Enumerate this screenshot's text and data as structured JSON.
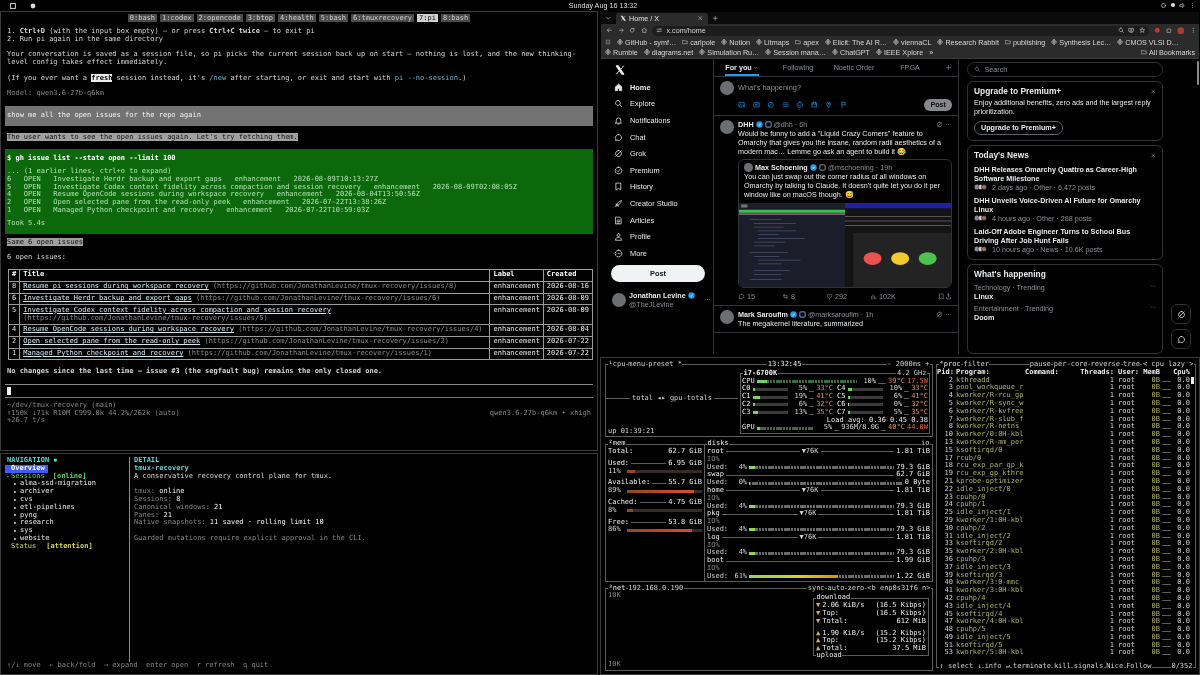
{
  "top_bar": {
    "clock": "Sunday Aug 16 13:32"
  },
  "terminal": {
    "windows": [
      {
        "label": "0:bash",
        "selected": false
      },
      {
        "label": "1:codex",
        "selected": false
      },
      {
        "label": "2:opencode",
        "selected": false
      },
      {
        "label": "3:btop",
        "selected": false
      },
      {
        "label": "4:health",
        "selected": false
      },
      {
        "label": "5:bash",
        "selected": false
      },
      {
        "label": "6:tmuxrecovery",
        "selected": false
      },
      {
        "label": "7:pi",
        "selected": true
      },
      {
        "label": "8:bash",
        "selected": false
      }
    ],
    "reply": {
      "steps": [
        "1. **Ctrl+D** (with the input box empty) — or press **Ctrl+C twice** — to exit pi",
        "2. Run pi again in the same directory"
      ],
      "paragraph": "Your conversation is saved as a session file, so pi picks the current session back up on start — nothing is lost, and the new thinking-level config takes effect immediately.",
      "note": [
        {
          "text": "(If you ever want a ",
          "kind": "plain"
        },
        {
          "text": "fresh",
          "kind": "highlight"
        },
        {
          "text": " session instead, it's ",
          "kind": "plain"
        },
        {
          "text": "/new",
          "kind": "command"
        },
        {
          "text": " after starting, or exit and start with ",
          "kind": "plain"
        },
        {
          "text": "pi --no-session",
          "kind": "command"
        },
        {
          "text": ".)",
          "kind": "plain"
        }
      ],
      "model": "Model: qwen3.6-27b-q6km"
    },
    "prompt": "show me all the open issues for the repo again",
    "thinking": "The user wants to see the open issues again. Let's try fetching them.",
    "tool": {
      "command": "$ gh issue list --state open --limit 100",
      "collapsed": "... (1 earlier lines, ctrl+o to expand)",
      "output": [
        "6   OPEN   Investigate Herdr backup and export gaps   enhancement   2026-08-09T10:13:27Z",
        "5   OPEN   Investigate Codex context fidelity across compaction and session recovery   enhancement   2026-08-09T02:08:05Z",
        "4   OPEN   Resume OpenCode sessions during workspace recovery   enhancement   2026-08-04T13:50:56Z",
        "2   OPEN   Open selected pane from the read-only peek   enhancement   2026-07-22T13:38:26Z",
        "1   OPEN   Managed Python checkpoint and recovery   enhancement   2026-07-22T10:59:03Z"
      ],
      "duration": "Took 5.4s"
    },
    "summary": "Same 6 open issues",
    "intro": "6 open issues:",
    "table": {
      "columns": [
        "#",
        "Title",
        "Label",
        "Created"
      ],
      "rows": [
        {
          "number": "8",
          "title": "Resume pi sessions during workspace recovery",
          "url": "(https://github.com/JonathanLevine/tmux-recovery/issues/8)",
          "label": "enhancement",
          "created": "2026-08-16"
        },
        {
          "number": "6",
          "title": "Investigate Herdr backup and export gaps",
          "url": "(https://github.com/JonathanLevine/tmux-recovery/issues/6)",
          "label": "enhancement",
          "created": "2026-08-09"
        },
        {
          "number": "5",
          "title": "Investigate Codex context fidelity across compaction and session recovery",
          "url": "(https://github.com/JonathanLevine/tmux-recovery/issues/5)",
          "label": "enhancement",
          "created": "2026-08-09"
        },
        {
          "number": "4",
          "title": "Resume OpenCode sessions during workspace recovery",
          "url": "(https://github.com/JonathanLevine/tmux-recovery/issues/4)",
          "label": "enhancement",
          "created": "2026-08-04"
        },
        {
          "number": "2",
          "title": "Open selected pane from the read-only peek",
          "url": "(https://github.com/JonathanLevine/tmux-recovery/issues/2)",
          "label": "enhancement",
          "created": "2026-07-22"
        },
        {
          "number": "1",
          "title": "Managed Python checkpoint and recovery",
          "url": "(https://github.com/JonathanLevine/tmux-recovery/issues/1)",
          "label": "enhancement",
          "created": "2026-07-22"
        }
      ]
    },
    "closing": "No changes since the last time — issue #3 (the segfault bug) remains the only closed one.",
    "footer": {
      "path": "~/dev/tmux-recovery (main)",
      "usage": "↑150k ↓71k R10M C999.0k 44.2%/262k (auto)",
      "speed": "+26.7 t/s",
      "model": "qwen3.6-27b-q6km • xhigh"
    }
  },
  "browser": {
    "tab": {
      "title": "Home / X"
    },
    "address": "x.com/home",
    "bookmarks": [
      {
        "label": "GitHub - symf…",
        "kind": "site"
      },
      {
        "label": "carlpole",
        "kind": "folder"
      },
      {
        "label": "Notion",
        "kind": "site"
      },
      {
        "label": "Litmaps",
        "kind": "site"
      },
      {
        "label": "apex",
        "kind": "folder"
      },
      {
        "label": "Elicit: The AI R…",
        "kind": "site"
      },
      {
        "label": "viennaCL",
        "kind": "site"
      },
      {
        "label": "Research Rabbit",
        "kind": "site"
      },
      {
        "label": "publishing",
        "kind": "folder"
      },
      {
        "label": "Synthesis Lec…",
        "kind": "site"
      },
      {
        "label": "CMOS VLSI D…",
        "kind": "site"
      },
      {
        "label": "Rumble",
        "kind": "site"
      },
      {
        "label": "diagrams.net",
        "kind": "site"
      },
      {
        "label": "Simulation Ru…",
        "kind": "site"
      },
      {
        "label": "Session mana…",
        "kind": "site"
      },
      {
        "label": "ChatGPT",
        "kind": "site"
      },
      {
        "label": "IEEE Xplore",
        "kind": "site"
      }
    ],
    "overflow": "»",
    "all_bookmarks": "All Bookmarks"
  },
  "x": {
    "nav": [
      {
        "label": "Home",
        "selected": true
      },
      {
        "label": "Explore",
        "selected": false
      },
      {
        "label": "Notifications",
        "selected": false
      },
      {
        "label": "Chat",
        "selected": false
      },
      {
        "label": "Grok",
        "selected": false
      },
      {
        "label": "Premium",
        "selected": false
      },
      {
        "label": "History",
        "selected": false
      },
      {
        "label": "Creator Studio",
        "selected": false
      },
      {
        "label": "Articles",
        "selected": false
      },
      {
        "label": "Profile",
        "selected": false
      },
      {
        "label": "More",
        "selected": false
      }
    ],
    "post_button": "Post",
    "account": {
      "name": "Jonathan Levine",
      "handle": "@TheJLevine"
    },
    "feed_tabs": [
      {
        "label": "For you",
        "selected": true
      },
      {
        "label": "Following",
        "selected": false
      },
      {
        "label": "Noetic Order",
        "selected": false
      },
      {
        "label": "FPGA",
        "selected": false
      }
    ],
    "composer": {
      "placeholder": "What's happening?",
      "post": "Post",
      "disabled": true
    },
    "tweets": [
      {
        "name": "DHH",
        "meta": "@dhh · 6h",
        "text": "Would be funny to add a \"Liquid Crazy Corners\" feature to Omarchy that gives you the insane, random radii aesthetics of a modern mac… Lemme go ask an agent to build it 😂",
        "quote": {
          "name": "Max Schoening",
          "meta": "@mschoening · 19h",
          "text": "You can just swap out the corner radius of all windows on Omarchy by talking to Claude. It doesn't quite let you do it per window like on macOS though. 😅"
        },
        "stats": [
          "15",
          "8",
          "292",
          "102K"
        ]
      },
      {
        "name": "Mark Saroufim",
        "meta": "@marksaroufim · 1h",
        "text": "The megakernel literature, summarized"
      }
    ],
    "search": {
      "placeholder": "Search"
    },
    "premium": {
      "title": "Upgrade to Premium+",
      "text": "Enjoy additional benefits, zero ads and the largest reply prioritization.",
      "button": "Upgrade to Premium+"
    },
    "news": {
      "title": "Today's News",
      "items": [
        {
          "headline": "DHH Releases Omarchy Quattro as Career-High Software Milestone",
          "meta": "2 days ago · Other · 6,472 posts"
        },
        {
          "headline": "DHH Unveils Voice-Driven AI Future for Omarchy Linux",
          "meta": "4 hours ago · Other · 288 posts"
        },
        {
          "headline": "Laid-Off Adobe Engineer Turns to School Bus Driving After Job Hunt Fails",
          "meta": "10 hours ago · News · 10.6K posts"
        }
      ]
    },
    "trends": {
      "title": "What's happening",
      "items": [
        {
          "context": "Technology · Trending",
          "topic": "Linux"
        },
        {
          "context": "Entertainment · Trending",
          "topic": "Doom"
        }
      ]
    }
  },
  "recovery": {
    "nav_title": "NAVIGATION ▪",
    "nav": [
      {
        "label": "Overview",
        "selected": true
      },
      {
        "label": "Sessions",
        "badge": "[online]",
        "color": "#5fd75f",
        "expanded": true,
        "selected": false,
        "children": [
          {
            "label": "alma-ssd-migration",
            "selected": false
          },
          {
            "label": "archiver",
            "selected": false
          },
          {
            "label": "cvs",
            "selected": false
          },
          {
            "label": "etl-pipelines",
            "selected": false
          },
          {
            "label": "pyng",
            "selected": false
          },
          {
            "label": "research",
            "selected": false
          },
          {
            "label": "sys",
            "selected": false
          },
          {
            "label": "website",
            "selected": false
          }
        ]
      },
      {
        "label": "Status",
        "badge": "[attention]",
        "color": "#d7d75f",
        "selected": false
      }
    ],
    "detail": {
      "title": "DETAIL",
      "name": "tmux-recovery",
      "description": "A conservative recovery control plane for tmux.",
      "fields": [
        {
          "label": "tmux:",
          "value": "online"
        },
        {
          "label": "Sessions:",
          "value": "8"
        },
        {
          "label": "Canonical windows:",
          "value": "21"
        },
        {
          "label": "Panes:",
          "value": "21"
        },
        {
          "label": "Native snapshots:",
          "value": "11 saved · rolling limit 10"
        }
      ],
      "note": "Guarded mutations require explicit approval in the CLI."
    },
    "help": "↑/↓ move  ← back/fold  → expand  enter open  r refresh  q quit"
  },
  "btop": {
    "cpu": {
      "title": "¹cpu",
      "menu": "menu",
      "preset": "preset *",
      "clock": "13:32:45",
      "interval": "- 2000ms +",
      "graph_label": "total ◂▸ gpu-totals",
      "uptime": "up 01:39:21",
      "model": "i7-6700K",
      "frequency": "4.2 GHz",
      "total": {
        "label": "CPU",
        "level": 0.1,
        "percent": "10%",
        "temp": "39°C",
        "power": "17.5W"
      },
      "cores": [
        {
          "label": "C0",
          "level": 0.05,
          "percent": "5%",
          "temp": "33°C"
        },
        {
          "label": "C4",
          "level": 0.1,
          "percent": "10%",
          "temp": "33°C"
        },
        {
          "label": "C1",
          "level": 0.19,
          "percent": "19%",
          "temp": "41°C"
        },
        {
          "label": "C5",
          "level": 0.06,
          "percent": "6%",
          "temp": "41°C"
        },
        {
          "label": "C2",
          "level": 0.06,
          "percent": "6%",
          "temp": "32°C"
        },
        {
          "label": "C6",
          "level": 0,
          "percent": "0%",
          "temp": "32°C"
        },
        {
          "label": "C3",
          "level": 0.13,
          "percent": "13%",
          "temp": "35°C"
        },
        {
          "label": "C7",
          "level": 0.05,
          "percent": "5%",
          "temp": "35°C"
        }
      ],
      "load": "Load avg: 0.36 0.45 0.38",
      "gpu": {
        "label": "GPU",
        "level": 0.05,
        "percent": "5%",
        "memory": "936M/8.0G",
        "temp": "40°C",
        "power": "44.0W"
      }
    },
    "mem": {
      "title": "²mem",
      "total": {
        "label": "Total:",
        "value": "62.7 GiB"
      },
      "items": [
        {
          "label": "Used:",
          "value": "6.95 GiB",
          "percent": "11%",
          "level": 0.11
        },
        {
          "label": "Available:",
          "value": "55.7 GiB",
          "percent": "89%",
          "level": 0.89
        },
        {
          "label": "Cached:",
          "value": "4.75 GiB",
          "percent": "8%",
          "level": 0.08
        },
        {
          "label": "Free:",
          "value": "53.8 GiB",
          "percent": "86%",
          "level": 0.86
        }
      ]
    },
    "disks": {
      "title": "disks",
      "io": "io",
      "items": [
        {
          "name": "root",
          "io": "▼76K",
          "size": "1.81 TiB",
          "io_label": "IO%",
          "used_label": "Used:",
          "used_percent": "4%",
          "level": 0.04,
          "used": "79.3 GiB"
        },
        {
          "name": "swap",
          "size": "62.7 GiB",
          "used_label": "Used:",
          "used_percent": "0%",
          "level": 0,
          "used": "0 Byte"
        },
        {
          "name": "home",
          "io": "▼76K",
          "size": "1.81 TiB",
          "io_label": "IO%",
          "used_label": "Used:",
          "used_percent": "4%",
          "level": 0.04,
          "used": "79.3 GiB"
        },
        {
          "name": "pkg",
          "io": "▼76K",
          "size": "1.81 TiB",
          "io_label": "IO%",
          "used_label": "Used:",
          "used_percent": "4%",
          "level": 0.04,
          "used": "79.3 GiB"
        },
        {
          "name": "log",
          "io": "▼76K",
          "size": "1.81 TiB",
          "io_label": "IO%",
          "used_label": "Used:",
          "used_percent": "4%",
          "level": 0.04,
          "used": "79.3 GiB"
        },
        {
          "name": "boot",
          "size": "1.99 GiB",
          "io_label": "IO%",
          "used_label": "Used:",
          "used_percent": "61%",
          "level": 0.61,
          "used": "1.22 GiB"
        }
      ]
    },
    "net": {
      "title": "³net",
      "address": "192.168.0.190",
      "controls": [
        "sync",
        "auto",
        "zero",
        "<b enp0s31f6 n>"
      ],
      "scale_top": "10K",
      "scale_bottom": "10K",
      "download_label": "download",
      "upload_label": "upload",
      "download": [
        {
          "arrow": "▼",
          "text": "2.06 KiB/s",
          "value": "(16.5 Kibps)"
        },
        {
          "arrow": "▼",
          "text": "Top:",
          "value": "(16.5 Kibps)"
        },
        {
          "arrow": "▼",
          "text": "Total:",
          "value": "612 MiB"
        }
      ],
      "upload": [
        {
          "arrow": "▲",
          "text": "1.90 KiB/s",
          "value": "(15.2 Kibps)"
        },
        {
          "arrow": "▲",
          "text": "Top:",
          "value": "(15.2 Kibps)"
        },
        {
          "arrow": "▲",
          "text": "Total:",
          "value": "37.5 MiB"
        }
      ]
    },
    "proc": {
      "title": "⁴proc",
      "filter": "filter",
      "options": [
        "pause",
        "per-core",
        "reverse",
        "tree",
        "< cpu lazy >"
      ],
      "columns": [
        "Pid:",
        "Program:",
        "Command:",
        "Threads:",
        "User:",
        "MemB",
        "Cpu%"
      ],
      "rows": [
        [
          "2",
          "kthreadd",
          "",
          "1",
          "root",
          "0B",
          "0.0"
        ],
        [
          "3",
          "pool_workqueue_r",
          "",
          "1",
          "root",
          "0B",
          "0.0"
        ],
        [
          "4",
          "kworker/R-rcu_gp",
          "",
          "1",
          "root",
          "0B",
          "0.0"
        ],
        [
          "5",
          "kworker/R-sync_w",
          "",
          "1",
          "root",
          "0B",
          "0.0"
        ],
        [
          "6",
          "kworker/R-kvfree",
          "",
          "1",
          "root",
          "0B",
          "0.0"
        ],
        [
          "7",
          "kworker/R-slub_f",
          "",
          "1",
          "root",
          "0B",
          "0.0"
        ],
        [
          "8",
          "kworker/R-netns",
          "",
          "1",
          "root",
          "0B",
          "0.0"
        ],
        [
          "10",
          "kworker/0:0H-kbl",
          "",
          "1",
          "root",
          "0B",
          "0.0"
        ],
        [
          "13",
          "kworker/R-mm_per",
          "",
          "1",
          "root",
          "0B",
          "0.0"
        ],
        [
          "15",
          "ksoftirqd/0",
          "",
          "1",
          "root",
          "0B",
          "0.0"
        ],
        [
          "17",
          "rcub/0",
          "",
          "1",
          "root",
          "0B",
          "0.0"
        ],
        [
          "18",
          "rcu_exp_par_gp_k",
          "",
          "1",
          "root",
          "0B",
          "0.0"
        ],
        [
          "19",
          "rcu_exp_gp_kthre",
          "",
          "1",
          "root",
          "0B",
          "0.0"
        ],
        [
          "21",
          "kprobe-optimizer",
          "",
          "1",
          "root",
          "0B",
          "0.0"
        ],
        [
          "22",
          "idle_inject/0",
          "",
          "1",
          "root",
          "0B",
          "0.0"
        ],
        [
          "23",
          "cpuhp/0",
          "",
          "1",
          "root",
          "0B",
          "0.0"
        ],
        [
          "24",
          "cpuhp/1",
          "",
          "1",
          "root",
          "0B",
          "0.0"
        ],
        [
          "25",
          "idle_inject/1",
          "",
          "1",
          "root",
          "0B",
          "0.0"
        ],
        [
          "29",
          "kworker/1:0H-kbl",
          "",
          "1",
          "root",
          "0B",
          "0.0"
        ],
        [
          "30",
          "cpuhp/2",
          "",
          "1",
          "root",
          "0B",
          "0.0"
        ],
        [
          "31",
          "idle_inject/2",
          "",
          "1",
          "root",
          "0B",
          "0.0"
        ],
        [
          "33",
          "ksoftirqd/2",
          "",
          "1",
          "root",
          "0B",
          "0.0"
        ],
        [
          "35",
          "kworker/2:0H-kbl",
          "",
          "1",
          "root",
          "0B",
          "0.0"
        ],
        [
          "36",
          "cpuhp/3",
          "",
          "1",
          "root",
          "0B",
          "0.0"
        ],
        [
          "37",
          "idle_inject/3",
          "",
          "1",
          "root",
          "0B",
          "0.0"
        ],
        [
          "39",
          "ksoftirqd/3",
          "",
          "1",
          "root",
          "0B",
          "0.0"
        ],
        [
          "40",
          "kworker/3:0-mmc",
          "",
          "1",
          "root",
          "0B",
          "0.0"
        ],
        [
          "41",
          "kworker/3:0H-kbl",
          "",
          "1",
          "root",
          "0B",
          "0.0"
        ],
        [
          "42",
          "cpuhp/4",
          "",
          "1",
          "root",
          "0B",
          "0.0"
        ],
        [
          "43",
          "idle_inject/4",
          "",
          "1",
          "root",
          "0B",
          "0.0"
        ],
        [
          "45",
          "ksoftirqd/4",
          "",
          "1",
          "root",
          "0B",
          "0.0"
        ],
        [
          "47",
          "kworker/4:0H-kbl",
          "",
          "1",
          "root",
          "0B",
          "0.0"
        ],
        [
          "48",
          "cpuhp/5",
          "",
          "1",
          "root",
          "0B",
          "0.0"
        ],
        [
          "49",
          "idle_inject/5",
          "",
          "1",
          "root",
          "0B",
          "0.0"
        ],
        [
          "51",
          "ksoftirqd/5",
          "",
          "1",
          "root",
          "0B",
          "0.0"
        ],
        [
          "53",
          "kworker/5:0H-kbl",
          "",
          "1",
          "root",
          "0B",
          "0.0"
        ]
      ],
      "keys": [
        "↑ select ↓",
        "info ↵",
        "terminate",
        "kill",
        "signals",
        "Nice",
        "Follow"
      ],
      "count": "0/352"
    }
  }
}
